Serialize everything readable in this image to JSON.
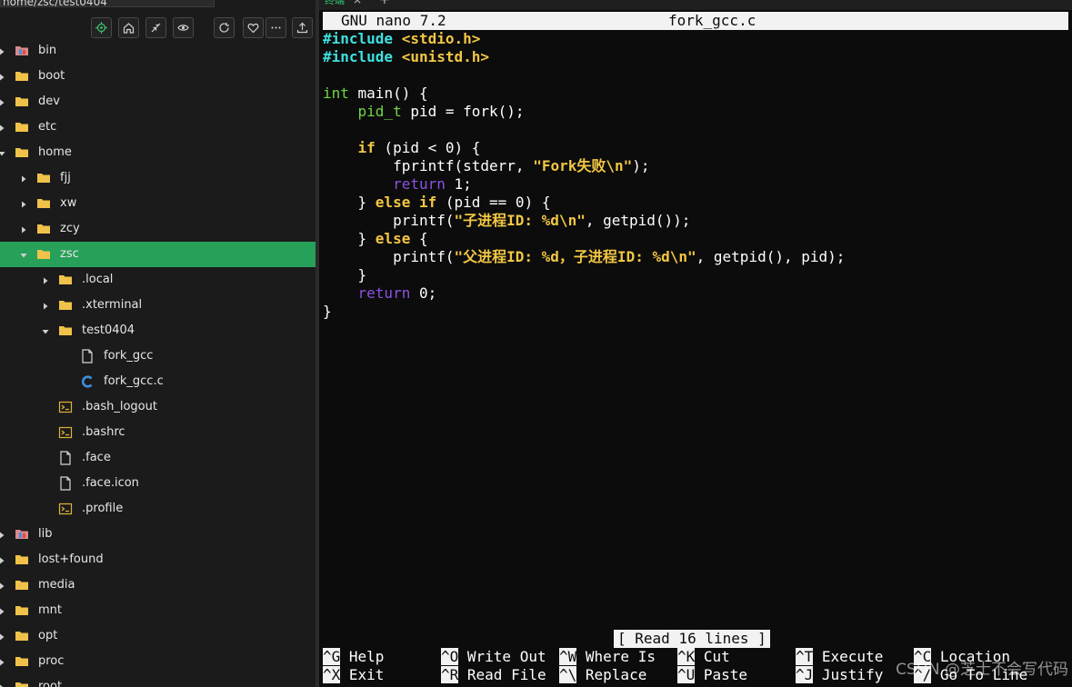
{
  "sidebar": {
    "path": "home/zsc/test0404",
    "toolbar": [
      {
        "name": "locate-icon"
      },
      {
        "name": "home-icon"
      },
      {
        "name": "collapse-icon"
      },
      {
        "name": "eye-icon"
      },
      {
        "name": "refresh-icon"
      },
      {
        "name": "heart-icon"
      },
      {
        "name": "more-icon"
      },
      {
        "name": "upload-icon"
      }
    ],
    "tree": [
      {
        "label": "bin",
        "depth": 0,
        "arrow": "right",
        "icon": "special-folder"
      },
      {
        "label": "boot",
        "depth": 0,
        "arrow": "right",
        "icon": "folder"
      },
      {
        "label": "dev",
        "depth": 0,
        "arrow": "right",
        "icon": "folder"
      },
      {
        "label": "etc",
        "depth": 0,
        "arrow": "right",
        "icon": "folder"
      },
      {
        "label": "home",
        "depth": 0,
        "arrow": "down",
        "icon": "folder"
      },
      {
        "label": "fjj",
        "depth": 1,
        "arrow": "right",
        "icon": "folder"
      },
      {
        "label": "xw",
        "depth": 1,
        "arrow": "right",
        "icon": "folder"
      },
      {
        "label": "zcy",
        "depth": 1,
        "arrow": "right",
        "icon": "folder"
      },
      {
        "label": "zsc",
        "depth": 1,
        "arrow": "down",
        "icon": "folder",
        "selected": true
      },
      {
        "label": ".local",
        "depth": 2,
        "arrow": "right",
        "icon": "folder"
      },
      {
        "label": ".xterminal",
        "depth": 2,
        "arrow": "right",
        "icon": "folder"
      },
      {
        "label": "test0404",
        "depth": 2,
        "arrow": "down",
        "icon": "folder"
      },
      {
        "label": "fork_gcc",
        "depth": 3,
        "arrow": "none",
        "icon": "file"
      },
      {
        "label": "fork_gcc.c",
        "depth": 3,
        "arrow": "none",
        "icon": "c-file"
      },
      {
        "label": ".bash_logout",
        "depth": 2,
        "arrow": "none",
        "icon": "script"
      },
      {
        "label": ".bashrc",
        "depth": 2,
        "arrow": "none",
        "icon": "script"
      },
      {
        "label": ".face",
        "depth": 2,
        "arrow": "none",
        "icon": "file"
      },
      {
        "label": ".face.icon",
        "depth": 2,
        "arrow": "none",
        "icon": "file"
      },
      {
        "label": ".profile",
        "depth": 2,
        "arrow": "none",
        "icon": "script"
      },
      {
        "label": "lib",
        "depth": 0,
        "arrow": "right",
        "icon": "special-folder"
      },
      {
        "label": "lost+found",
        "depth": 0,
        "arrow": "right",
        "icon": "folder"
      },
      {
        "label": "media",
        "depth": 0,
        "arrow": "right",
        "icon": "folder"
      },
      {
        "label": "mnt",
        "depth": 0,
        "arrow": "right",
        "icon": "folder"
      },
      {
        "label": "opt",
        "depth": 0,
        "arrow": "right",
        "icon": "folder"
      },
      {
        "label": "proc",
        "depth": 0,
        "arrow": "right",
        "icon": "folder"
      },
      {
        "label": "root",
        "depth": 0,
        "arrow": "right",
        "icon": "folder"
      }
    ]
  },
  "terminal": {
    "tab_label": "终端",
    "tab_close": "×",
    "tab_add": "+",
    "nano_title": "GNU nano 7.2",
    "file_name": "fork_gcc.c",
    "code_lines": [
      [
        [
          "inc",
          "#include "
        ],
        [
          "hdr",
          "<stdio.h>"
        ]
      ],
      [
        [
          "inc",
          "#include "
        ],
        [
          "hdr",
          "<unistd.h>"
        ]
      ],
      [],
      [
        [
          "typ",
          "int"
        ],
        [
          "",
          " main() {"
        ]
      ],
      [
        [
          "",
          "    "
        ],
        [
          "typ",
          "pid_t"
        ],
        [
          "",
          " pid = fork();"
        ]
      ],
      [],
      [
        [
          "",
          "    "
        ],
        [
          "kw",
          "if"
        ],
        [
          "",
          " (pid < 0) {"
        ]
      ],
      [
        [
          "",
          "        fprintf(stderr, "
        ],
        [
          "str",
          "\"Fork失败\\n\""
        ],
        [
          "",
          ");"
        ]
      ],
      [
        [
          "",
          "        "
        ],
        [
          "kw2",
          "return"
        ],
        [
          "",
          " 1;"
        ]
      ],
      [
        [
          "",
          "    } "
        ],
        [
          "kw",
          "else if"
        ],
        [
          "",
          " (pid == 0) {"
        ]
      ],
      [
        [
          "",
          "        printf("
        ],
        [
          "str",
          "\"子进程ID: %d\\n\""
        ],
        [
          "",
          ", getpid());"
        ]
      ],
      [
        [
          "",
          "    } "
        ],
        [
          "kw",
          "else"
        ],
        [
          "",
          " {"
        ]
      ],
      [
        [
          "",
          "        printf("
        ],
        [
          "str",
          "\"父进程ID: %d，子进程ID: %d\\n\""
        ],
        [
          "",
          ", getpid(), pid);"
        ]
      ],
      [
        [
          "",
          "    }"
        ]
      ],
      [
        [
          "",
          "    "
        ],
        [
          "kw2",
          "return"
        ],
        [
          "",
          " 0;"
        ]
      ],
      [
        [
          "",
          "}"
        ]
      ]
    ],
    "status_message": "[ Read 16 lines ]",
    "shortcuts_row1": [
      {
        "key": "^G",
        "label": "Help"
      },
      {
        "key": "^O",
        "label": "Write Out"
      },
      {
        "key": "^W",
        "label": "Where Is"
      },
      {
        "key": "^K",
        "label": "Cut"
      },
      {
        "key": "^T",
        "label": "Execute"
      },
      {
        "key": "^C",
        "label": "Location"
      }
    ],
    "shortcuts_row2": [
      {
        "key": "^X",
        "label": "Exit"
      },
      {
        "key": "^R",
        "label": "Read File"
      },
      {
        "key": "^\\",
        "label": "Replace"
      },
      {
        "key": "^U",
        "label": "Paste"
      },
      {
        "key": "^J",
        "label": "Justify"
      },
      {
        "key": "^/",
        "label": "Go To Line"
      }
    ],
    "watermark": "CSDN @芝士不会写代码"
  },
  "colors": {
    "selected_row": "#27a05a",
    "folder": "#f0c24a",
    "include": "#3fe0e0",
    "string": "#f2c744",
    "type": "#6ed843",
    "return": "#8a52e0"
  }
}
